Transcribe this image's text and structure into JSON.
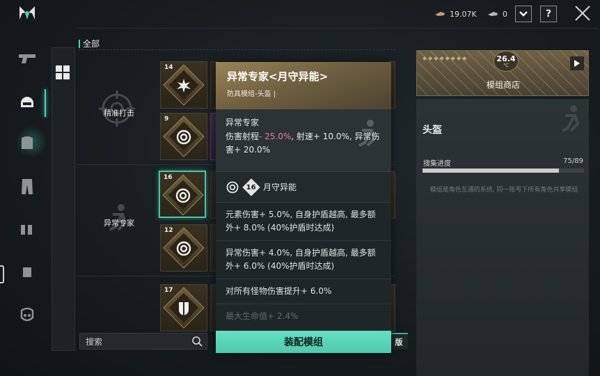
{
  "topbar": {
    "currency_1": "19.07K",
    "currency_2": "0",
    "dropdown_icon": "chevron-down",
    "help_label": "?"
  },
  "left_nav": [
    "pistol-icon",
    "helmet-icon",
    "armor-icon",
    "pants-icon",
    "boots-icon",
    "glove-icon",
    "mask-icon"
  ],
  "section": {
    "title": "全部"
  },
  "groups": [
    {
      "name": "精准打击",
      "cards": [
        {
          "level": "14",
          "icon": "explosion-icon"
        },
        {
          "level": "9",
          "icon": "swirl-icon"
        }
      ]
    },
    {
      "name": "异常专家",
      "cards": [
        {
          "level": "16",
          "icon": "swirl-icon"
        },
        {
          "level": "12",
          "icon": "swirl-icon"
        }
      ]
    },
    {
      "name": "",
      "cards": [
        {
          "level": "17",
          "icon": "shield-icon"
        }
      ]
    }
  ],
  "search": {
    "placeholder": "搜索"
  },
  "right_tag": "版",
  "popup": {
    "title": "异常专家<月守异能>",
    "subtitle": "防具模组-头盔 |",
    "desc_name": "异常专家",
    "desc_stat_1": "伤害射程",
    "desc_stat_1_value": "- 25.0%",
    "desc_stat_rest": ", 射速+ 10.0%, 异常伤害+ 20.0%",
    "set_level": "16",
    "set_name": "月守异能",
    "effects": [
      "元素伤害+ 5.0%, 自身护盾越高, 最多额外+ 8.0% (40%护盾时达成)",
      "异常伤害+ 4.0%, 自身护盾越高, 最多额外+ 6.0% (40%护盾时达成)",
      "对所有怪物伤害提升+ 6.0%",
      "最大生命值+ 2.4%"
    ],
    "equip_label": "装配模组"
  },
  "shop": {
    "temp": "26.4",
    "temp_unit": "℃",
    "label": "模组商店"
  },
  "info": {
    "title": "头盔",
    "progress_label": "搜集进度",
    "progress_count": "75/89",
    "progress_fraction": 0.843,
    "description": "模组是角色互通的系统, 同一账号下所有角色共享模组"
  }
}
